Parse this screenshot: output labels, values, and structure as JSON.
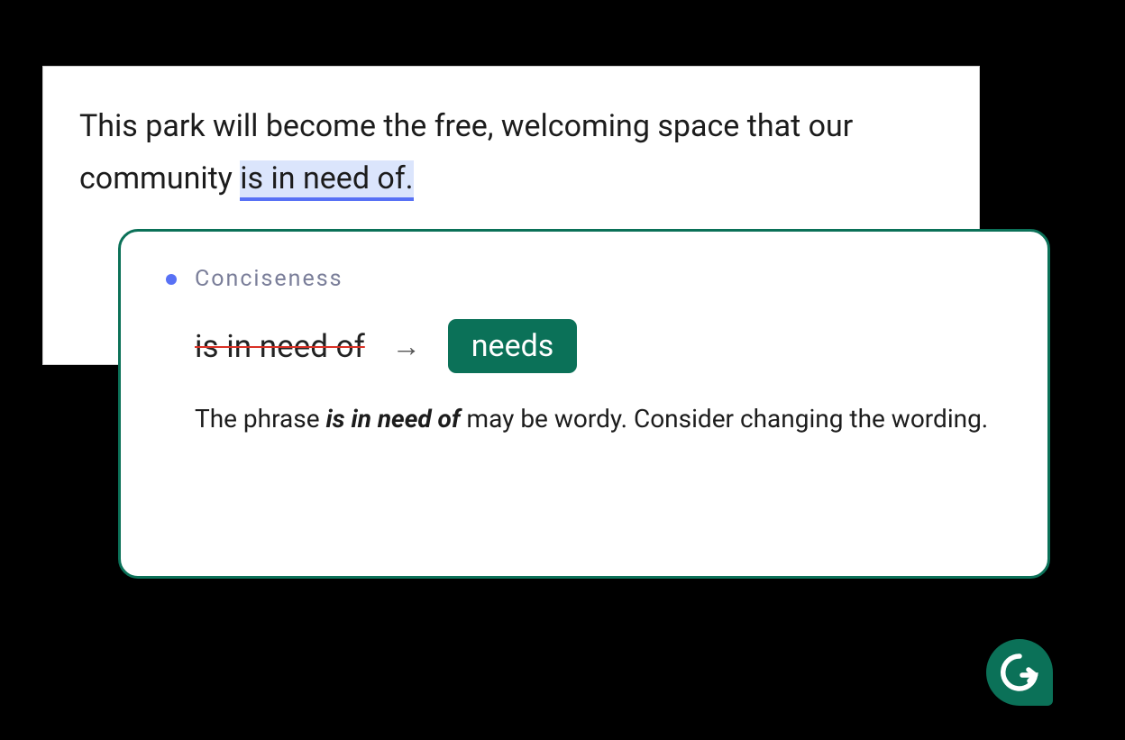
{
  "editor": {
    "sentence_prefix": "This park will become the free, welcoming space that our community ",
    "highlighted_phrase": "is in need of.",
    "highlight_color": "#dbe5fc",
    "underline_color": "#5871f5"
  },
  "suggestion": {
    "bullet_color": "#5871f5",
    "category": "Conciseness",
    "original": "is in need of",
    "arrow": "→",
    "replacement": "needs",
    "replacement_bg": "#0b7158",
    "explanation_prefix": "The phrase ",
    "explanation_emph": "is in need of",
    "explanation_suffix": " may be wordy. Consider changing the wording.",
    "border_color": "#0b7158"
  },
  "brand": {
    "letter": "G",
    "bg_color": "#0b7158"
  }
}
